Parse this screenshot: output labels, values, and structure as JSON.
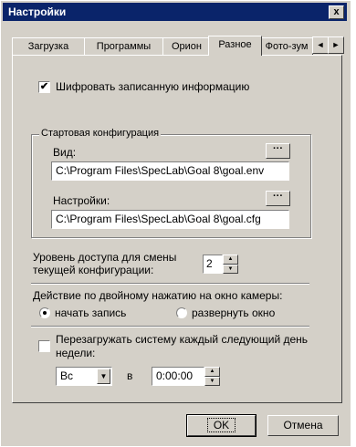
{
  "window": {
    "title": "Настройки",
    "close": "x"
  },
  "tabs": [
    {
      "label": "Загрузка"
    },
    {
      "label": "Программы"
    },
    {
      "label": "Орион"
    },
    {
      "label": "Разное"
    },
    {
      "label": "Фото-зум"
    }
  ],
  "tab_scroll": {
    "left": "◄",
    "right": "►"
  },
  "encrypt": {
    "label": "Шифровать записанную информацию",
    "checked": true,
    "mark": "✔"
  },
  "startup": {
    "group_title": "Стартовая конфигурация",
    "view_label": "Вид:",
    "view_value": "C:\\Program Files\\SpecLab\\Goal 8\\goal.env",
    "settings_label": "Настройки:",
    "settings_value": "C:\\Program Files\\SpecLab\\Goal 8\\goal.cfg",
    "browse": "···"
  },
  "access": {
    "label_line1": "Уровень доступа для смены",
    "label_line2": "текущей конфигурации:",
    "value": "2"
  },
  "dblclick": {
    "label": "Действие по двойному нажатию на окно камеры:",
    "option_record": "начать запись",
    "option_expand": "развернуть окно",
    "selected": "record"
  },
  "reboot": {
    "label_line1": "Перезагружать систему каждый следующий день",
    "label_line2": "недели:",
    "checked": false,
    "day": "Вс",
    "at": "в",
    "time": "0:00:00"
  },
  "buttons": {
    "ok": "OK",
    "cancel": "Отмена"
  }
}
